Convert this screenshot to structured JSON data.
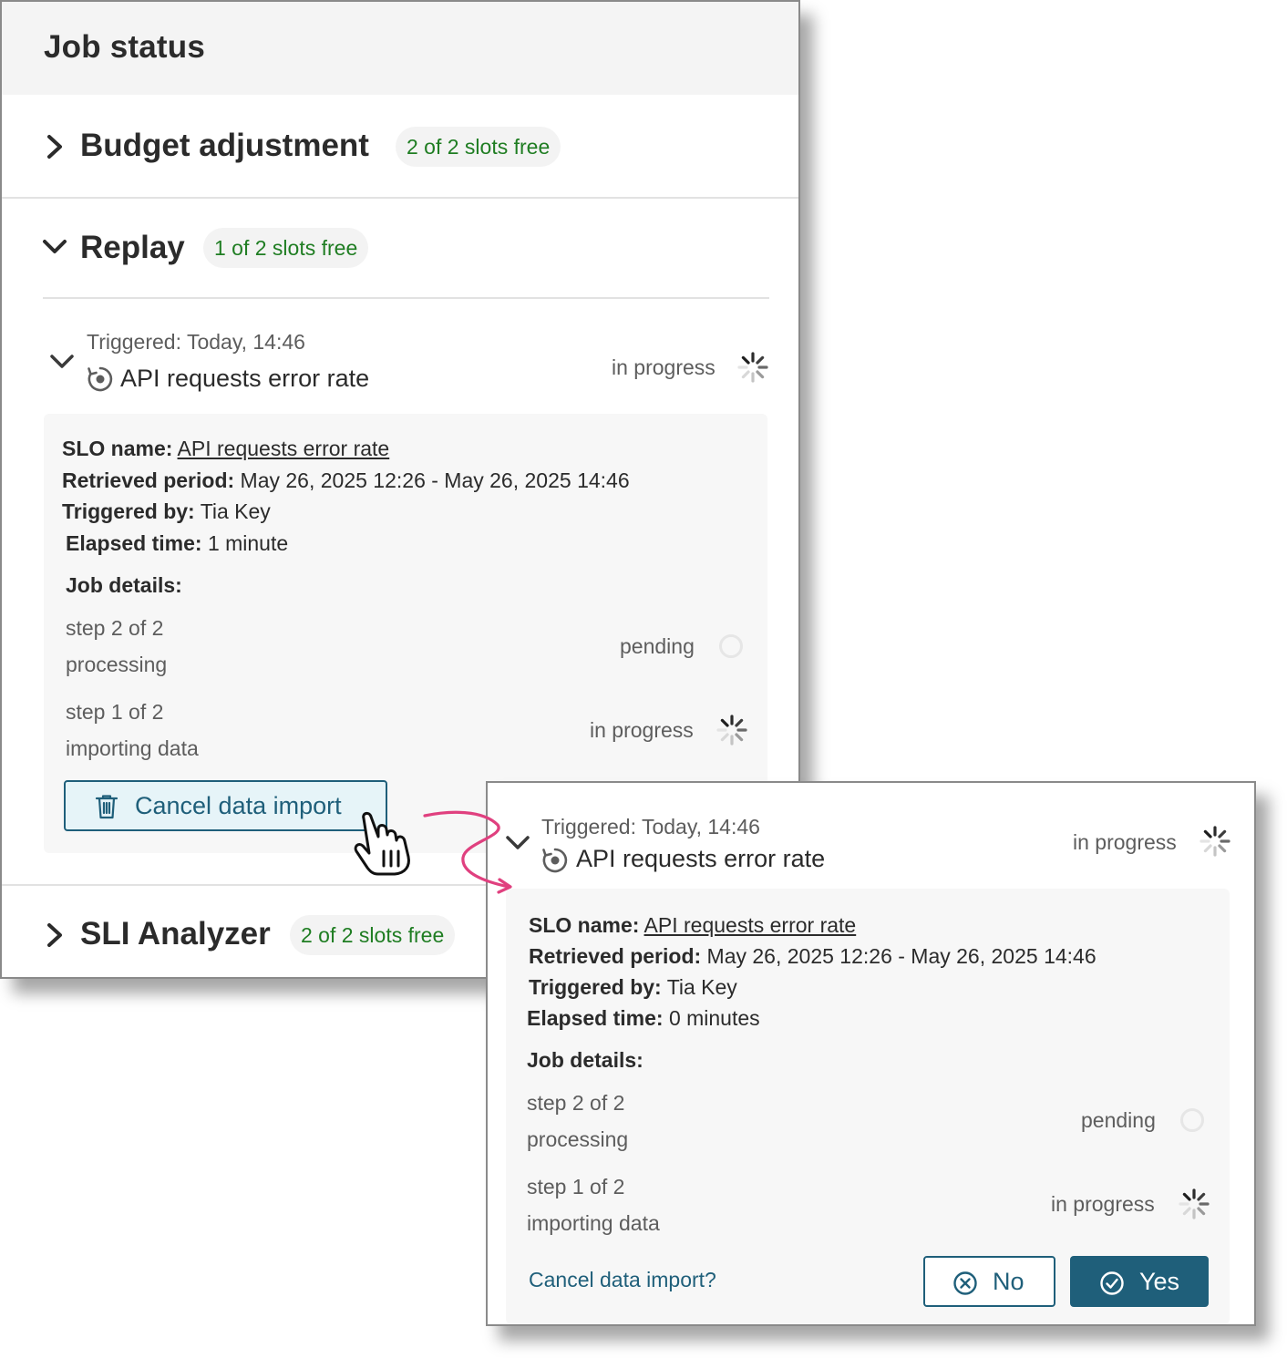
{
  "header": {
    "title": "Job status"
  },
  "sections": [
    {
      "title": "Budget adjustment",
      "badge": "2 of 2 slots free",
      "expanded": false
    },
    {
      "title": "Replay",
      "badge": "1 of 2 slots free",
      "expanded": true
    },
    {
      "title": "SLI Analyzer",
      "badge": "2 of 2 slots free",
      "expanded": false
    }
  ],
  "replay_job": {
    "triggered": "Triggered: Today, 14:46",
    "name": "API requests error rate",
    "status": "in progress",
    "slo_label": "SLO name:",
    "slo_value": "API requests error rate",
    "period_label": "Retrieved period:",
    "period_value": "May 26, 2025 12:26 - May 26, 2025 14:46",
    "by_label": "Triggered by:",
    "by_value": "Tia Key",
    "elapsed_label": "Elapsed time:",
    "elapsed_value": "1 minute",
    "details_label": "Job details:",
    "steps": [
      {
        "step": "step 2 of 2",
        "desc": "processing",
        "status": "pending"
      },
      {
        "step": "step 1 of 2",
        "desc": "importing data",
        "status": "in progress"
      }
    ],
    "cancel_button": "Cancel data import"
  },
  "confirm_view": {
    "triggered": "Triggered: Today, 14:46",
    "name": "API requests error rate",
    "status": "in progress",
    "slo_label": "SLO name:",
    "slo_value": "API requests error rate",
    "period_label": "Retrieved period:",
    "period_value": "May 26, 2025 12:26 - May 26, 2025 14:46",
    "by_label": "Triggered by:",
    "by_value": "Tia Key",
    "elapsed_label": "Elapsed time:",
    "elapsed_value": "0 minutes",
    "details_label": "Job details:",
    "steps": [
      {
        "step": "step 2 of 2",
        "desc": "processing",
        "status": "pending"
      },
      {
        "step": "step 1 of 2",
        "desc": "importing data",
        "status": "in progress"
      }
    ],
    "question": "Cancel data import?",
    "no_button": "No",
    "yes_button": "Yes"
  },
  "colors": {
    "primary": "#1f5f7a",
    "badge_green": "#1f7d22",
    "arrow_pink": "#e0407f"
  },
  "icons": {
    "chevron": "chevron-icon",
    "spinner": "spinner-icon",
    "pending": "pending-circle-icon",
    "trash": "trash-icon",
    "cursor": "hand-pointer-cursor-icon"
  }
}
